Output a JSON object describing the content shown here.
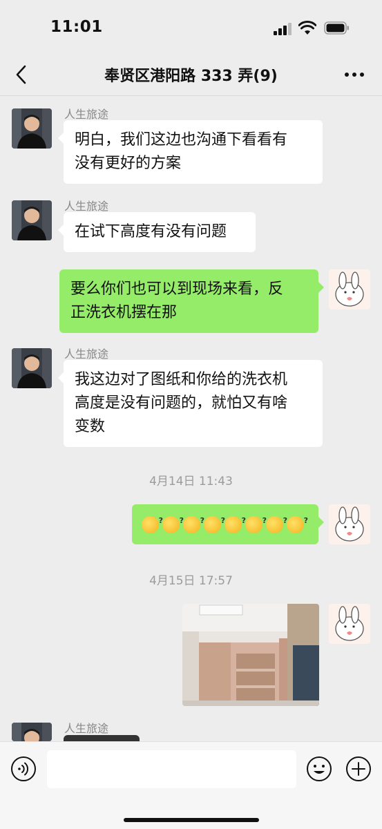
{
  "status": {
    "time": "11:01"
  },
  "header": {
    "title": "奉贤区港阳路 333 弄(9)"
  },
  "messages": [
    {
      "sender": "人生旅途",
      "text": "明白，我们这边也沟通下看看有\n没有更好的方案"
    },
    {
      "sender": "人生旅途",
      "text": "在试下高度有没有问题"
    },
    {
      "text": "要么你们也可以到现场来看，反\n正洗衣机摆在那"
    },
    {
      "sender": "人生旅途",
      "text": "我这边对了图纸和你给的洗衣机\n高度是没有问题的，就怕又有啥\n变数"
    },
    {
      "timestamp": "4月14日 11:43"
    },
    {
      "emoji": "thinking-question-emoji",
      "count": 8
    },
    {
      "timestamp": "4月15日 17:57"
    },
    {
      "image": "cabinet-photo"
    },
    {
      "sender": "人生旅途"
    }
  ],
  "input": {
    "placeholder": ""
  },
  "colors": {
    "outgoing": "#95ec69",
    "incoming": "#ffffff",
    "background": "#ededed"
  }
}
